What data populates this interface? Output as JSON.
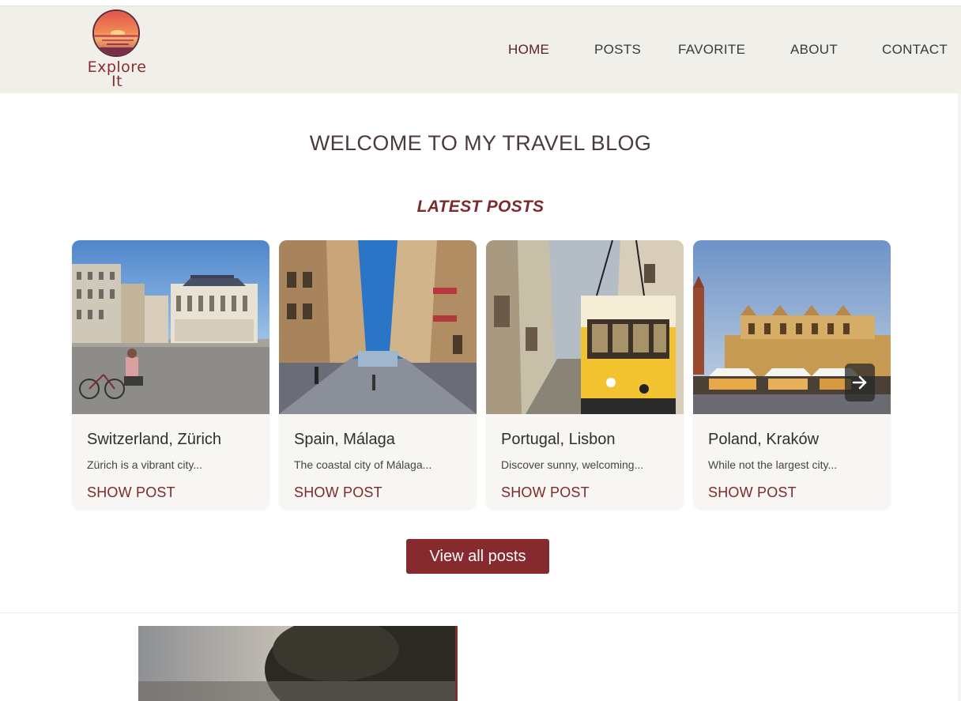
{
  "header": {
    "logo": {
      "line1": "Explore",
      "line2": "It"
    },
    "nav": [
      {
        "label": "HOME",
        "active": true
      },
      {
        "label": "POSTS",
        "active": false
      },
      {
        "label": "FAVORITE",
        "active": false
      },
      {
        "label": "ABOUT",
        "active": false
      },
      {
        "label": "CONTACT",
        "active": false
      }
    ]
  },
  "main": {
    "welcome": "WELCOME TO MY TRAVEL BLOG",
    "latest_heading": "LATEST POSTS",
    "posts": [
      {
        "title": "Switzerland, Zürich",
        "excerpt": "Zürich is a vibrant city...",
        "link": "SHOW POST"
      },
      {
        "title": "Spain, Málaga",
        "excerpt": "The coastal city of Málaga...",
        "link": "SHOW POST"
      },
      {
        "title": "Portugal, Lisbon",
        "excerpt": "Discover sunny, welcoming...",
        "link": "SHOW POST"
      },
      {
        "title": "Poland, Kraków",
        "excerpt": "While not the largest city...",
        "link": "SHOW POST"
      }
    ],
    "view_all_label": "View all posts"
  },
  "colors": {
    "accent": "#862a2e",
    "header_bg": "#f1efea",
    "card_bg": "#f8f6f2"
  },
  "icons": {
    "carousel_next": "arrow-right-icon"
  }
}
